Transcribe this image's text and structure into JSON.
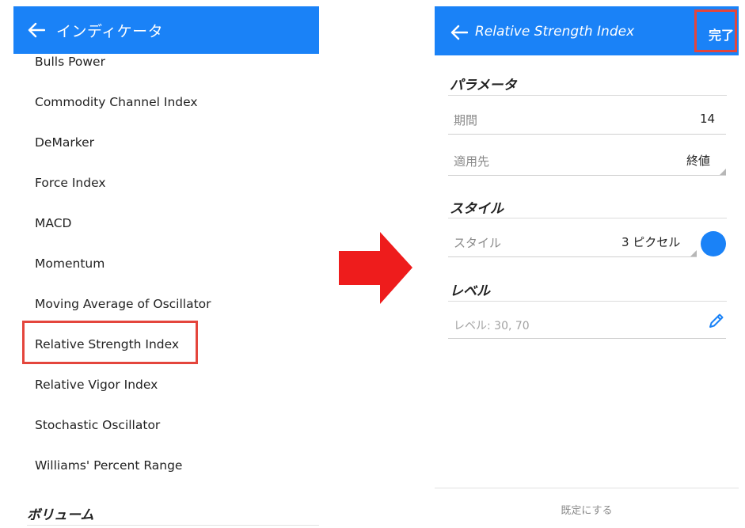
{
  "left": {
    "title": "インディケータ",
    "items": [
      "Bulls Power",
      "Commodity Channel Index",
      "DeMarker",
      "Force Index",
      "MACD",
      "Momentum",
      "Moving Average of Oscillator",
      "Relative Strength Index",
      "Relative Vigor Index",
      "Stochastic Oscillator",
      "Williams' Percent Range"
    ],
    "section_volume": "ボリューム"
  },
  "right": {
    "title": "Relative Strength Index",
    "done_label": "完了",
    "params": {
      "header": "パラメータ",
      "period_label": "期間",
      "period_value": "14",
      "apply_label": "適用先",
      "apply_value": "終値"
    },
    "style": {
      "header": "スタイル",
      "style_label": "スタイル",
      "style_value": "3 ピクセル",
      "color": "#1a82f7"
    },
    "levels": {
      "header": "レベル",
      "levels_placeholder": "レベル: 30, 70"
    },
    "reset_label": "既定にする"
  },
  "colors": {
    "appbar": "#1a82f7",
    "highlight": "#e4453c",
    "arrow": "#ee1c1c"
  },
  "icons": {
    "back": "arrow-left-icon",
    "pencil": "pencil-icon",
    "arrow": "right-arrow-icon"
  }
}
